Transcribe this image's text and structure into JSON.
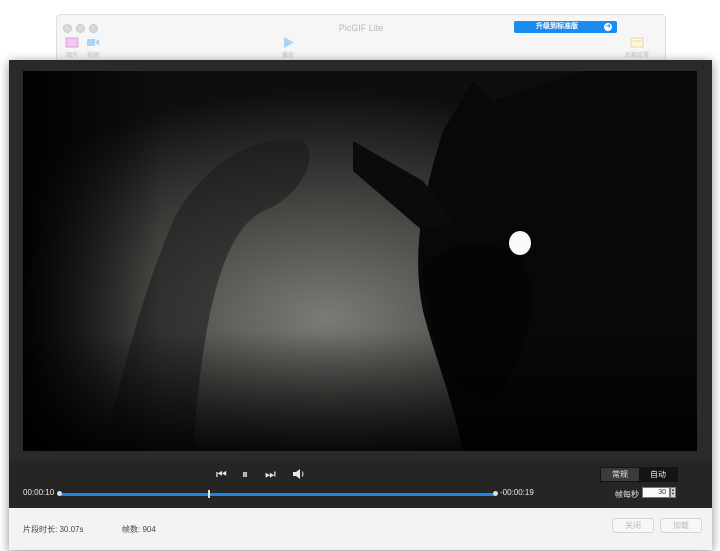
{
  "window": {
    "title": "PicGIF Lite",
    "upgrade_label": "升级到标准版",
    "toolbar": [
      {
        "label": "图片",
        "icon": "image-icon"
      },
      {
        "label": "视频",
        "icon": "video-camera-icon"
      },
      {
        "label": "播放",
        "icon": "play-icon"
      },
      {
        "label": "后期设置",
        "icon": "settings-panel-icon"
      }
    ]
  },
  "player": {
    "icons": [
      "previous-frame-icon",
      "pause-icon",
      "next-frame-icon",
      "volume-icon"
    ],
    "time_elapsed": "00:00:10",
    "time_remaining": "-00:00:19",
    "playback_progress": 0.344,
    "mode_options": [
      "常规",
      "自动"
    ],
    "mode_selected": "自动",
    "fps_label": "帧每秒",
    "fps_value": "30"
  },
  "footer": {
    "duration": "片段时长: 30.07s",
    "frames": "帧数: 904",
    "close_label": "关闭",
    "load_label": "加载"
  },
  "colors": {
    "accent": "#1a86e6",
    "sheet_bg": "#2a2a2a",
    "footer_bg": "#f3f3f3"
  }
}
